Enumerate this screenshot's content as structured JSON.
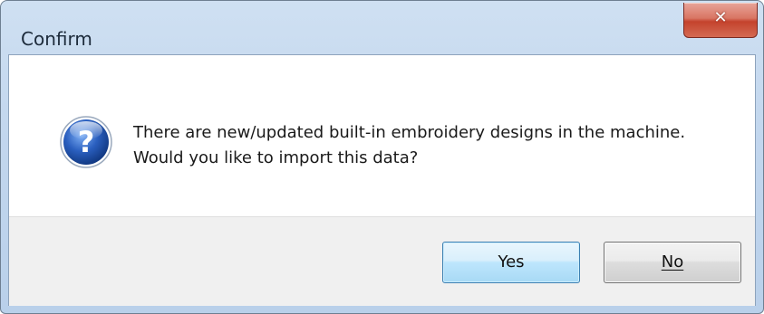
{
  "window": {
    "title": "Confirm",
    "close_icon": "close-icon"
  },
  "dialog": {
    "icon": "question-icon",
    "message_line1": "There are new/updated built-in embroidery designs in the machine.",
    "message_line2": "Would you like to import this data?"
  },
  "buttons": {
    "yes_label": "Yes",
    "no_label": "No"
  },
  "colors": {
    "title_bar": "#c3d7ee",
    "close_button": "#d97563",
    "default_button": "#bee6fd",
    "footer": "#f0f0f0",
    "icon_blue": "#2a5fbf"
  }
}
